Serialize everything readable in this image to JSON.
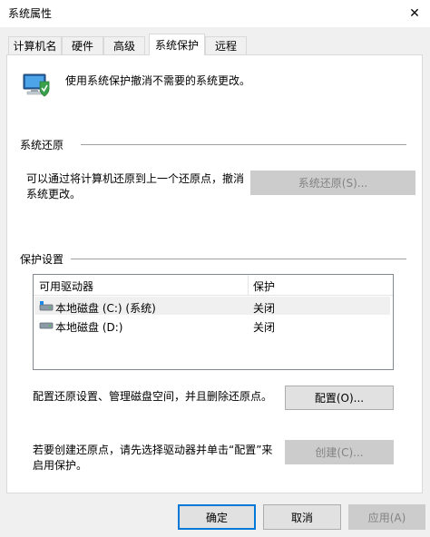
{
  "window": {
    "title": "系统属性",
    "close_glyph": "✕"
  },
  "tabs": [
    {
      "label": "计算机名"
    },
    {
      "label": "硬件"
    },
    {
      "label": "高级"
    },
    {
      "label": "系统保护"
    },
    {
      "label": "远程"
    }
  ],
  "active_tab": "系统保护",
  "header": {
    "description": "使用系统保护撤消不需要的系统更改。"
  },
  "restore": {
    "section_title": "系统还原",
    "text_line1": "可以通过将计算机还原到上一个还原点，撤消",
    "text_line2": "系统更改。",
    "button_label": "系统还原(S)..."
  },
  "protection": {
    "section_title": "保护设置",
    "columns": [
      "可用驱动器",
      "保护"
    ],
    "drives": [
      {
        "name": "本地磁盘 (C:) (系统)",
        "status": "关闭",
        "icon": "system-drive-icon"
      },
      {
        "name": "本地磁盘 (D:)",
        "status": "关闭",
        "icon": "drive-icon"
      }
    ],
    "config_text": "配置还原设置、管理磁盘空间，并且删除还原点。",
    "config_button": "配置(O)...",
    "create_text_line1": "若要创建还原点，请先选择驱动器并单击“配置”来",
    "create_text_line2": "启用保护。",
    "create_button": "创建(C)..."
  },
  "footer": {
    "ok": "确定",
    "cancel": "取消",
    "apply": "应用(A)"
  }
}
